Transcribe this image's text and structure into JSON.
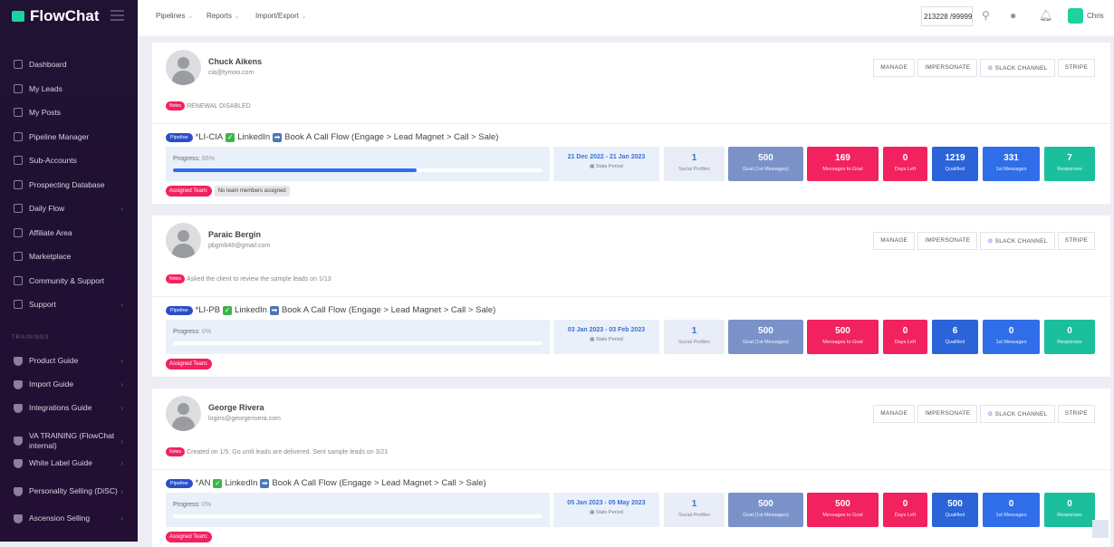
{
  "brand": {
    "name": "FlowChat",
    "accent": "#1fd1a0"
  },
  "sidebar": {
    "items": [
      {
        "label": "Dashboard",
        "icon": "dashboard-icon"
      },
      {
        "label": "My Leads",
        "icon": "leads-icon"
      },
      {
        "label": "My Posts",
        "icon": "posts-icon"
      },
      {
        "label": "Pipeline Manager",
        "icon": "pipeline-icon"
      },
      {
        "label": "Sub-Accounts",
        "icon": "sub-accounts-icon"
      },
      {
        "label": "Prospecting Database",
        "icon": "search-icon"
      },
      {
        "label": "Daily Flow",
        "icon": "refresh-icon",
        "chevron": true
      },
      {
        "label": "Affiliate Area",
        "icon": "affiliate-icon"
      },
      {
        "label": "Marketplace",
        "icon": "marketplace-icon"
      },
      {
        "label": "Community & Support",
        "icon": "chat-icon"
      },
      {
        "label": "Support",
        "icon": "help-icon",
        "chevron": true
      }
    ],
    "section_label": "TRAININGS",
    "trainings": [
      {
        "label": "Product Guide"
      },
      {
        "label": "Import Guide"
      },
      {
        "label": "Integrations Guide"
      },
      {
        "label": "VA TRAINING (FlowChat internal)"
      },
      {
        "label": "White Label Guide"
      },
      {
        "label": "Personality Selling (DiSC)"
      },
      {
        "label": "Ascension Selling"
      }
    ]
  },
  "topbar": {
    "menus": [
      "Pipelines",
      "Reports",
      "Import/Export"
    ],
    "search_value": "213228 /99999",
    "user": "Chris"
  },
  "actions": [
    "MANAGE",
    "IMPERSONATE",
    "SLACK CHANNEL",
    "STRIPE"
  ],
  "labels": {
    "notes": "Notes",
    "pipeline": "Pipeline",
    "progress": "Progress:",
    "stats_period": "Stats Period",
    "assigned_team": "Assigned Team:",
    "stats": [
      "Social Profiles",
      "Goal (1st Messages)",
      "Messages to Goal",
      "Days Left",
      "Qualified",
      "1st Messages",
      "Responses"
    ]
  },
  "stat_colors": [
    "#e8edf7",
    "#7b92c9",
    "#f2215f",
    "#f2215f",
    "#2b63d9",
    "#2f6ee8",
    "#1bbf9c"
  ],
  "clients": [
    {
      "name": "Chuck Aikens",
      "email": "cia@tymoo.com",
      "note": "RENEWAL DISABLED",
      "pipeline_code": "*LI-CIA",
      "pipeline_a": "LinkedIn",
      "pipeline_b": "Book A Call Flow (Engage > Lead Magnet > Call > Sale)",
      "progress": "66%",
      "progress_value": 66,
      "period": "21 Dec 2022 - 21 Jan 2023",
      "stats": [
        "1",
        "500",
        "169",
        "0",
        "1219",
        "331",
        "7"
      ],
      "team": "No team members assigned"
    },
    {
      "name": "Paraic Bergin",
      "email": "pbgmb48@gmail.com",
      "note": "Asked the client to review the sample leads on 1/13",
      "pipeline_code": "*LI-PB",
      "pipeline_a": "LinkedIn",
      "pipeline_b": "Book A Call Flow (Engage > Lead Magnet > Call > Sale)",
      "progress": "0%",
      "progress_value": 0,
      "period": "03 Jan 2023 - 03 Feb 2023",
      "stats": [
        "1",
        "500",
        "500",
        "0",
        "6",
        "0",
        "0"
      ]
    },
    {
      "name": "George Rivera",
      "email": "logins@georgerivera.com",
      "note": "Created on 1/5. Go until leads are delivered. Sent sample leads on 3/21",
      "pipeline_code": "*AN",
      "pipeline_a": "LinkedIn",
      "pipeline_b": "Book A Call Flow (Engage > Lead Magnet > Call > Sale)",
      "progress": "0%",
      "progress_value": 0,
      "period": "05 Jan 2023 - 05 May 2023",
      "stats": [
        "1",
        "500",
        "500",
        "0",
        "500",
        "0",
        "0"
      ]
    }
  ]
}
